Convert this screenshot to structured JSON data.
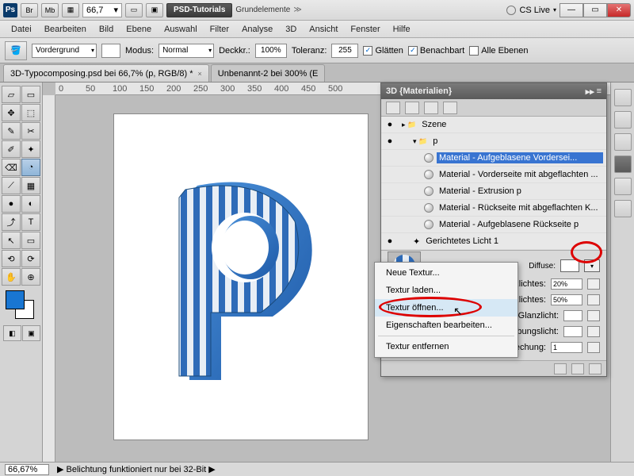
{
  "app": {
    "icon_text": "Ps"
  },
  "titlebar": {
    "zoom": "66,7",
    "doc_button": "PSD-Tutorials",
    "doc_plain": "Grundelemente",
    "cslive": "CS Live"
  },
  "winbtns": {
    "min": "—",
    "max": "▭",
    "close": "✕"
  },
  "menu": [
    "Datei",
    "Bearbeiten",
    "Bild",
    "Ebene",
    "Auswahl",
    "Filter",
    "Analyse",
    "3D",
    "Ansicht",
    "Fenster",
    "Hilfe"
  ],
  "optbar": {
    "fill_label": "Vordergrund",
    "mode_label": "Modus:",
    "mode_value": "Normal",
    "opacity_label": "Deckkr.:",
    "opacity_value": "100%",
    "tolerance_label": "Toleranz:",
    "tolerance_value": "255",
    "antialias": "Glätten",
    "contiguous": "Benachbart",
    "alllayers": "Alle Ebenen"
  },
  "tabs": [
    "3D-Typocomposing.psd bei 66,7% (p, RGB/8) *",
    "Unbenannt-2 bei 300% (E"
  ],
  "tools": [
    "▱",
    "▭",
    "✥",
    "⬚",
    "✎",
    "✂",
    "✐",
    "✦",
    "⌫",
    "◔",
    "⟋",
    "▦",
    "●",
    "◐",
    "⤴",
    "T",
    "↖",
    "▭",
    "✋",
    "⊕",
    "Q"
  ],
  "panel3d": {
    "title": "3D {Materialien}",
    "tree": [
      {
        "eye": "●",
        "indent": 0,
        "icon": "folder",
        "label": "Szene"
      },
      {
        "eye": "●",
        "indent": 1,
        "icon": "folder",
        "label": "p",
        "toggle": "▾"
      },
      {
        "eye": "",
        "indent": 2,
        "icon": "sphere",
        "label": "Material - Aufgeblasene Vordersei...",
        "selected": true
      },
      {
        "eye": "",
        "indent": 2,
        "icon": "sphere",
        "label": "Material - Vorderseite mit abgeflachten ..."
      },
      {
        "eye": "",
        "indent": 2,
        "icon": "sphere",
        "label": "Material - Extrusion p"
      },
      {
        "eye": "",
        "indent": 2,
        "icon": "sphere",
        "label": "Material - Rückseite mit abgeflachten K..."
      },
      {
        "eye": "",
        "indent": 2,
        "icon": "sphere",
        "label": "Material - Aufgeblasene Rückseite p"
      },
      {
        "eye": "●",
        "indent": 1,
        "icon": "light",
        "label": "Gerichtetes Licht 1"
      }
    ],
    "diffuse_label": "Diffuse:",
    "props": [
      {
        "label": "Intensität des Glanzlichtes:",
        "value": "20%"
      },
      {
        "label": "Größe des Glanzlichtes:",
        "value": "50%"
      },
      {
        "label": "Glanzlicht:",
        "swatch": true
      },
      {
        "label": "Umgebungslicht:",
        "swatch": true
      },
      {
        "label": "Brechung:",
        "value": "1"
      }
    ]
  },
  "ctxmenu": {
    "items": [
      "Neue Textur...",
      "Textur laden...",
      "Textur öffnen...",
      "Eigenschaften bearbeiten...",
      "Textur entfernen"
    ],
    "hover_index": 2
  },
  "status": {
    "zoom": "66,67%",
    "msg": "Belichtung funktioniert nur bei 32-Bit"
  },
  "ruler_marks": [
    "0",
    "50",
    "100",
    "150",
    "200",
    "250",
    "300",
    "350",
    "400",
    "450",
    "500"
  ]
}
